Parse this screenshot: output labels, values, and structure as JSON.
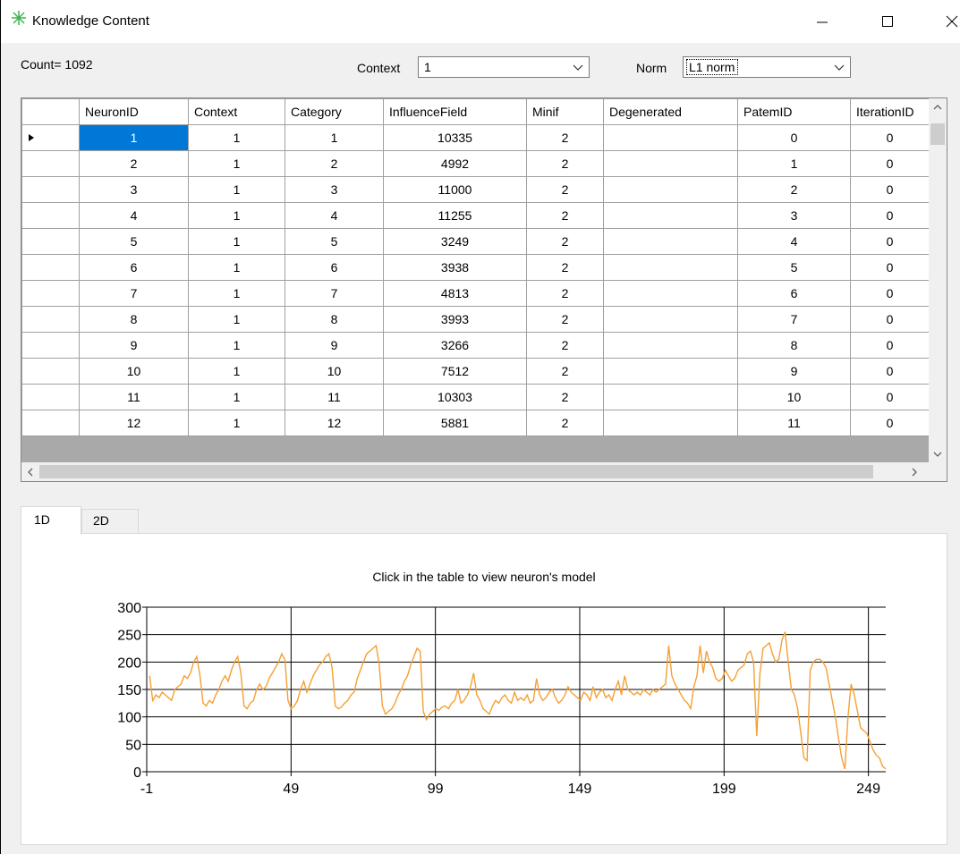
{
  "window": {
    "title": "Knowledge Content",
    "icon": "sparkle-icon"
  },
  "count_label": "Count= 1092",
  "context": {
    "label": "Context",
    "value": "1"
  },
  "norm": {
    "label": "Norm",
    "value": "L1 norm"
  },
  "table": {
    "columns": [
      "NeuronID",
      "Context",
      "Category",
      "InfluenceField",
      "Minif",
      "Degenerated",
      "PatemID",
      "IterationID"
    ],
    "rows": [
      [
        "1",
        "1",
        "1",
        "10335",
        "2",
        "",
        "0",
        "0"
      ],
      [
        "2",
        "1",
        "2",
        "4992",
        "2",
        "",
        "1",
        "0"
      ],
      [
        "3",
        "1",
        "3",
        "11000",
        "2",
        "",
        "2",
        "0"
      ],
      [
        "4",
        "1",
        "4",
        "11255",
        "2",
        "",
        "3",
        "0"
      ],
      [
        "5",
        "1",
        "5",
        "3249",
        "2",
        "",
        "4",
        "0"
      ],
      [
        "6",
        "1",
        "6",
        "3938",
        "2",
        "",
        "5",
        "0"
      ],
      [
        "7",
        "1",
        "7",
        "4813",
        "2",
        "",
        "6",
        "0"
      ],
      [
        "8",
        "1",
        "8",
        "3993",
        "2",
        "",
        "7",
        "0"
      ],
      [
        "9",
        "1",
        "9",
        "3266",
        "2",
        "",
        "8",
        "0"
      ],
      [
        "10",
        "1",
        "10",
        "7512",
        "2",
        "",
        "9",
        "0"
      ],
      [
        "11",
        "1",
        "11",
        "10303",
        "2",
        "",
        "10",
        "0"
      ],
      [
        "12",
        "1",
        "12",
        "5881",
        "2",
        "",
        "11",
        "0"
      ]
    ]
  },
  "tabs": [
    "1D",
    "2D"
  ],
  "chart_data": {
    "type": "line",
    "title": "Click in the table to view neuron's model",
    "xlim": [
      -1,
      255
    ],
    "ylim": [
      0,
      300
    ],
    "x_ticks": [
      -1,
      49,
      99,
      149,
      199,
      249
    ],
    "y_ticks": [
      0,
      50,
      100,
      150,
      200,
      250,
      300
    ],
    "grid": true,
    "color": "#f5a035",
    "series": [
      {
        "values": [
          175,
          130,
          140,
          135,
          145,
          140,
          135,
          130,
          150,
          155,
          160,
          175,
          170,
          180,
          200,
          210,
          175,
          125,
          120,
          130,
          125,
          140,
          150,
          165,
          175,
          165,
          185,
          200,
          210,
          180,
          120,
          115,
          125,
          130,
          150,
          160,
          150,
          155,
          170,
          180,
          190,
          200,
          215,
          205,
          130,
          115,
          120,
          130,
          150,
          165,
          145,
          160,
          175,
          185,
          195,
          200,
          210,
          215,
          190,
          120,
          115,
          118,
          125,
          130,
          140,
          145,
          170,
          185,
          200,
          215,
          220,
          225,
          230,
          195,
          120,
          105,
          110,
          115,
          125,
          140,
          150,
          165,
          175,
          195,
          210,
          225,
          220,
          110,
          95,
          105,
          110,
          115,
          112,
          118,
          120,
          115,
          125,
          130,
          150,
          125,
          130,
          140,
          155,
          180,
          140,
          130,
          115,
          110,
          105,
          120,
          130,
          125,
          135,
          140,
          130,
          125,
          145,
          130,
          135,
          130,
          140,
          125,
          130,
          170,
          140,
          130,
          135,
          145,
          150,
          135,
          125,
          130,
          140,
          155,
          145,
          140,
          135,
          130,
          145,
          140,
          130,
          155,
          135,
          145,
          150,
          135,
          140,
          130,
          150,
          165,
          140,
          175,
          150,
          145,
          140,
          145,
          140,
          150,
          145,
          140,
          150,
          145,
          150,
          155,
          160,
          230,
          175,
          160,
          150,
          140,
          130,
          125,
          115,
          155,
          175,
          230,
          180,
          220,
          200,
          190,
          170,
          165,
          170,
          185,
          175,
          165,
          170,
          185,
          190,
          195,
          215,
          220,
          200,
          65,
          180,
          225,
          230,
          235,
          215,
          200,
          205,
          240,
          255,
          200,
          150,
          140,
          115,
          70,
          25,
          20,
          185,
          200,
          205,
          205,
          200,
          190,
          160,
          130,
          100,
          60,
          25,
          5,
          100,
          160,
          140,
          110,
          80,
          75,
          70,
          55,
          40,
          30,
          25,
          10,
          5
        ]
      }
    ]
  }
}
